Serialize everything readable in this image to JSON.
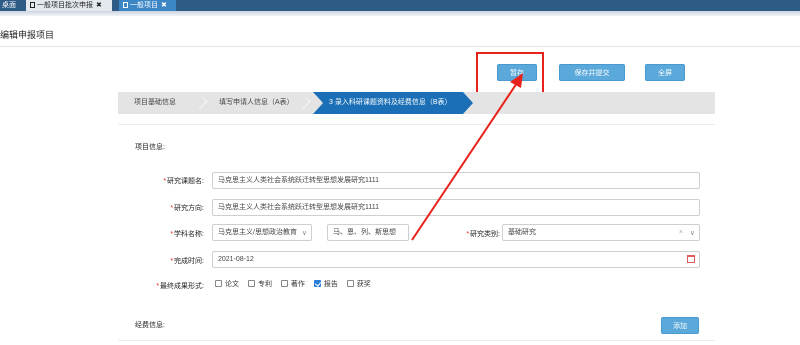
{
  "tabs": [
    {
      "label": "桌面"
    },
    {
      "label": "一般项目批次申报"
    },
    {
      "label": "一般项目"
    }
  ],
  "tab_close_glyph": "✖",
  "page_title": "编辑申报项目",
  "toolbar": {
    "save_label": "暂存",
    "submit_label": "保存并提交",
    "close_label": "全屏"
  },
  "steps": [
    {
      "label": "项目基础信息"
    },
    {
      "label": "填写申请人信息（A表）"
    },
    {
      "label": "3  录入科研课题资料及经费信息（B表）",
      "active": true
    }
  ],
  "sections": {
    "project_info": "项目信息:",
    "funding_info": "经费信息:"
  },
  "form": {
    "topic": {
      "label": "研究课题名:",
      "value": "马克思主义人类社会系统跃迁转型思想发展研究1111",
      "required": true
    },
    "direction": {
      "label": "研究方向:",
      "value": "马克思主义人类社会系统跃迁转型思想发展研究1111",
      "required": true
    },
    "discipline": {
      "label": "学科名称:",
      "value": "马克思主义/思想政治教育",
      "sub_value": "马、恩、列、斯思想",
      "required": true
    },
    "research_type": {
      "label": "研究类别:",
      "value": "基础研究",
      "required": true
    },
    "completion_date": {
      "label": "完成时间:",
      "value": "2021-08-12",
      "required": true
    },
    "outcome_form": {
      "label": "最终成果形式:",
      "required": true,
      "options": [
        {
          "label": "论文",
          "checked": false
        },
        {
          "label": "专利",
          "checked": false
        },
        {
          "label": "著作",
          "checked": false
        },
        {
          "label": "报告",
          "checked": true
        },
        {
          "label": "获奖",
          "checked": false
        }
      ]
    }
  },
  "add_button_label": "添加",
  "colors": {
    "accent": "#1a6fb6",
    "button": "#5aa9da",
    "annotation": "#e8221b",
    "required": "#e02020",
    "tabbar": "#2e5a86"
  },
  "icons": [
    "document-icon",
    "close-icon",
    "chevron-down-icon",
    "calendar-icon",
    "clear-icon",
    "checkbox-icon"
  ]
}
